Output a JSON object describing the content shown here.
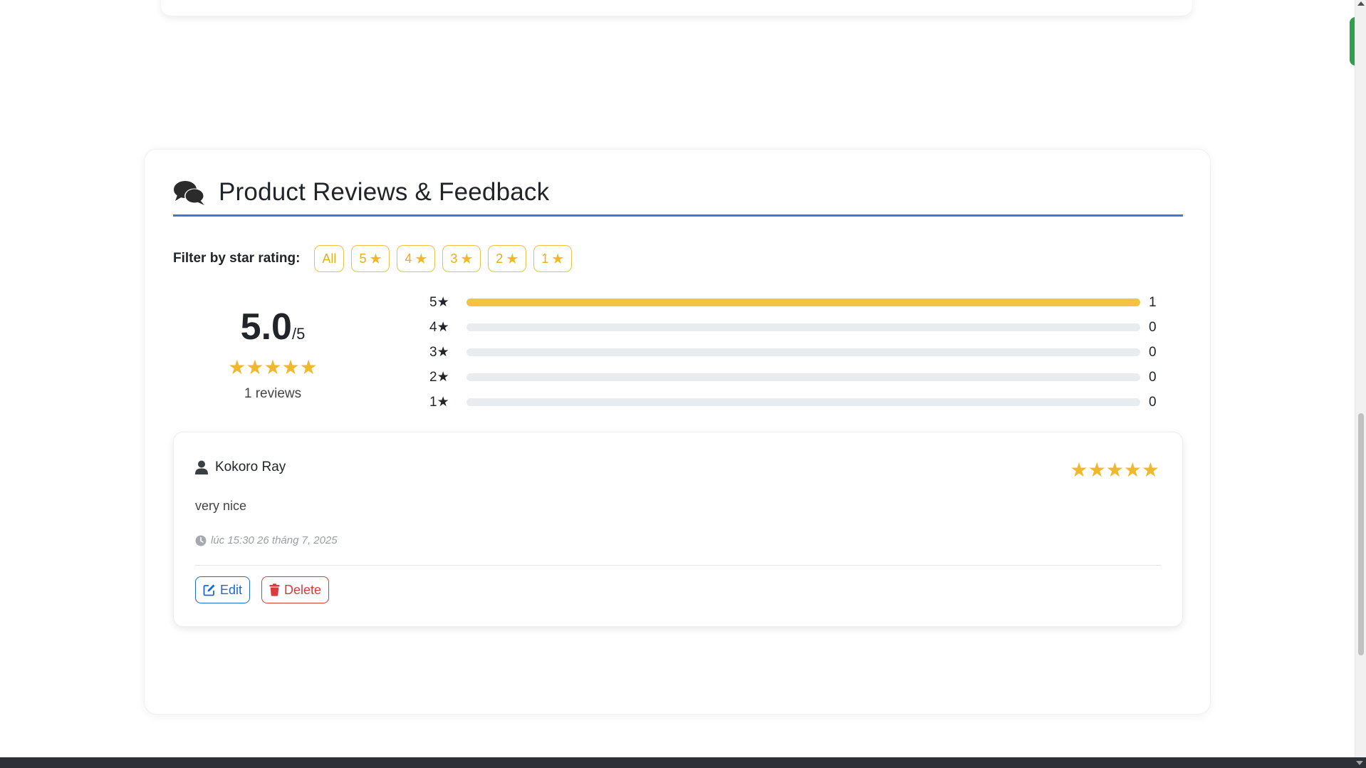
{
  "colors": {
    "accent_blue": "#3a7bd5",
    "star_gold": "#f0b82e",
    "bar_fill": "#f5c242",
    "edit_blue": "#1a6ad6",
    "delete_red": "#d93a3a"
  },
  "reviews_section": {
    "title": "Product Reviews & Feedback",
    "icon": "comments-icon",
    "filter": {
      "label": "Filter by star rating:",
      "options": [
        {
          "label": "All",
          "has_star": false
        },
        {
          "label": "5",
          "has_star": true
        },
        {
          "label": "4",
          "has_star": true
        },
        {
          "label": "3",
          "has_star": true
        },
        {
          "label": "2",
          "has_star": true
        },
        {
          "label": "1",
          "has_star": true
        }
      ]
    },
    "summary": {
      "average": "5.0",
      "out_of": "/5",
      "stars": "★★★★★",
      "count_text": "1 reviews"
    },
    "distribution": [
      {
        "label": "5★",
        "count": "1",
        "fraction": 1.0
      },
      {
        "label": "4★",
        "count": "0",
        "fraction": 0
      },
      {
        "label": "3★",
        "count": "0",
        "fraction": 0
      },
      {
        "label": "2★",
        "count": "0",
        "fraction": 0
      },
      {
        "label": "1★",
        "count": "0",
        "fraction": 0
      }
    ],
    "reviews": [
      {
        "author": "Kokoro Ray",
        "stars": "★★★★★",
        "text": "very nice",
        "time": "lúc 15:30 26 tháng 7, 2025",
        "edit_label": "Edit",
        "delete_label": "Delete"
      }
    ]
  }
}
